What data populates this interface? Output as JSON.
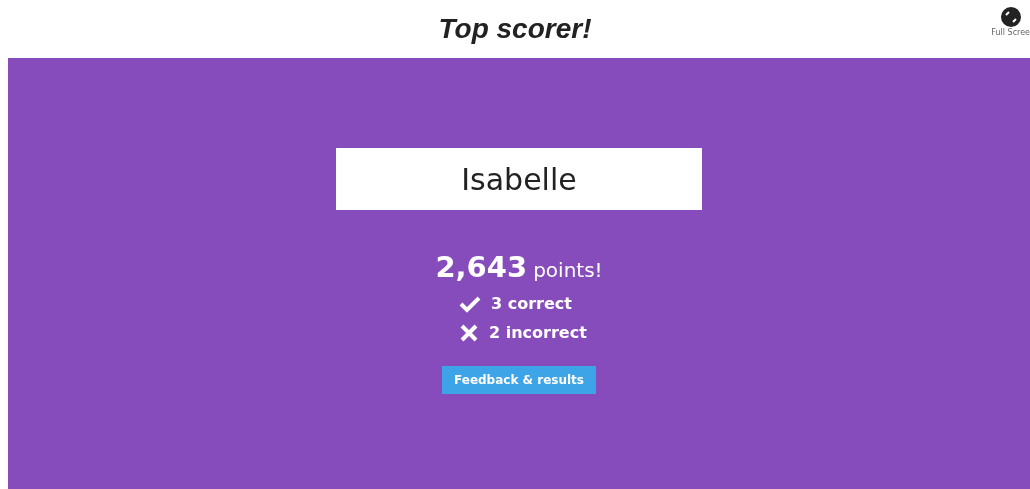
{
  "header": {
    "title": "Top scorer!",
    "fullscreen_label": "Full Scree"
  },
  "player": {
    "name": "Isabelle"
  },
  "score": {
    "value": "2,643",
    "unit": "points!"
  },
  "results": [
    {
      "kind": "correct",
      "label": "3 correct"
    },
    {
      "kind": "incorrect",
      "label": "2 incorrect"
    }
  ],
  "button": {
    "label": "Feedback & results"
  }
}
